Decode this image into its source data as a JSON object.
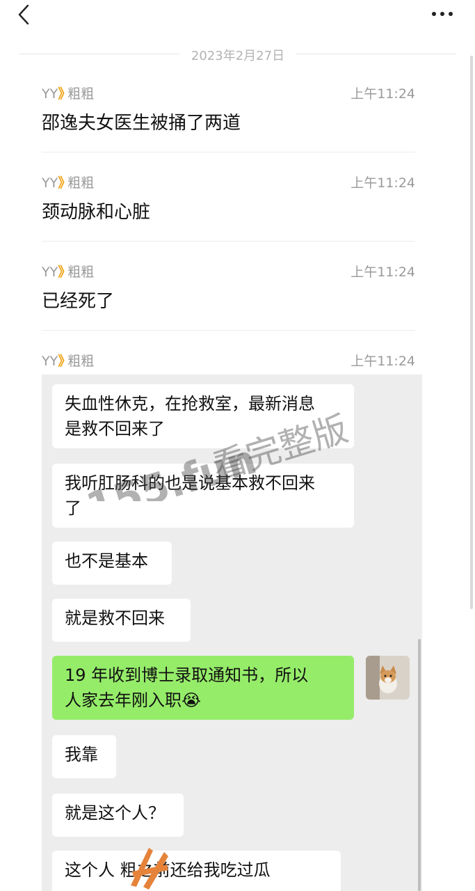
{
  "nav": {
    "back_icon": "chevron-left-icon",
    "more_icon": "more-horizontal-icon"
  },
  "date_label": "2023年2月27日",
  "messages": [
    {
      "sender": "YY",
      "separator": "》",
      "recipient": "粗粗",
      "time": "上午11:24",
      "text": "邵逸夫女医生被捅了两道"
    },
    {
      "sender": "YY",
      "separator": "》",
      "recipient": "粗粗",
      "time": "上午11:24",
      "text": "颈动脉和心脏"
    },
    {
      "sender": "YY",
      "separator": "》",
      "recipient": "粗粗",
      "time": "上午11:24",
      "text": "已经死了"
    },
    {
      "sender": "YY",
      "separator": "》",
      "recipient": "粗粗",
      "time": "上午11:24"
    }
  ],
  "screenshot_bubbles": [
    {
      "line1": "失血性休克，在抢救室，最新消息",
      "line2": "是救不回来了",
      "color": "white"
    },
    {
      "line1": "我听肛肠科的也是说基本救不回来",
      "line2": "了",
      "color": "white"
    },
    {
      "line1": "也不是基本",
      "color": "white"
    },
    {
      "line1": "就是救不回来",
      "color": "white"
    },
    {
      "line1": "19 年收到博士录取通知书，所以",
      "line2": "人家去年刚入职😭",
      "color": "#95ec69"
    },
    {
      "line1": "我靠",
      "color": "white"
    },
    {
      "line1": "就是这个人？",
      "color": "white"
    },
    {
      "line1": "这个人  粗之前还给我吃过瓜",
      "color": "white"
    }
  ],
  "watermark": {
    "site": "155.fun",
    "caption": "看完整版"
  }
}
